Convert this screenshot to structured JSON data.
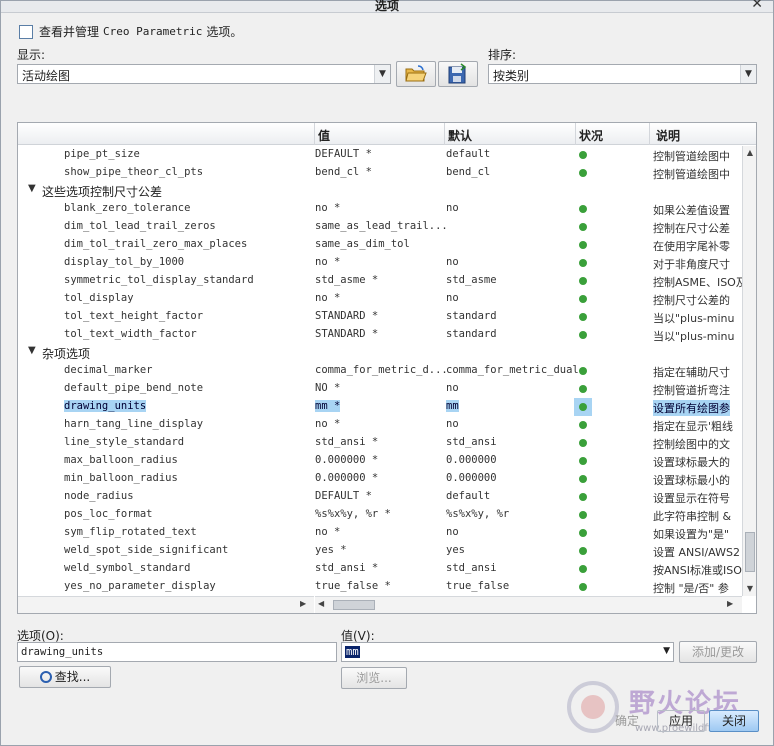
{
  "window": {
    "title": "选项"
  },
  "checkbox": {
    "label_prefix": "查看并管理",
    "label_product": "Creo Parametric",
    "label_suffix": "选项。"
  },
  "display": {
    "label": "显示:",
    "value": "活动绘图"
  },
  "sort": {
    "label": "排序:",
    "value": "按类别"
  },
  "toolbar": {
    "open_icon": "folder-open-icon",
    "save_icon": "save-icon"
  },
  "table": {
    "columns": [
      "值",
      "默认",
      "状况",
      "说明"
    ],
    "rows": [
      {
        "type": "opt",
        "name": "pipe_pt_size",
        "value": "DEFAULT *",
        "default": "default",
        "desc": "控制管道绘图中"
      },
      {
        "type": "opt",
        "name": "show_pipe_theor_cl_pts",
        "value": "bend_cl *",
        "default": "bend_cl",
        "desc": "控制管道绘图中"
      },
      {
        "type": "group",
        "label": "这些选项控制尺寸公差"
      },
      {
        "type": "opt",
        "name": "blank_zero_tolerance",
        "value": "no *",
        "default": "no",
        "desc": "如果公差值设置"
      },
      {
        "type": "opt",
        "name": "dim_tol_lead_trail_zeros",
        "value": "same_as_lead_trail...",
        "default": "",
        "desc": "控制在尺寸公差"
      },
      {
        "type": "opt",
        "name": "dim_tol_trail_zero_max_places",
        "value": "same_as_dim_tol",
        "default": "",
        "desc": "在使用字尾补零"
      },
      {
        "type": "opt",
        "name": "display_tol_by_1000",
        "value": "no *",
        "default": "no",
        "desc": "对于非角度尺寸"
      },
      {
        "type": "opt",
        "name": "symmetric_tol_display_standard",
        "value": "std_asme *",
        "default": "std_asme",
        "desc": "控制ASME、ISO及"
      },
      {
        "type": "opt",
        "name": "tol_display",
        "value": "no *",
        "default": "no",
        "desc": "控制尺寸公差的"
      },
      {
        "type": "opt",
        "name": "tol_text_height_factor",
        "value": "STANDARD *",
        "default": "standard",
        "desc": "当以\"plus-minu"
      },
      {
        "type": "opt",
        "name": "tol_text_width_factor",
        "value": "STANDARD *",
        "default": "standard",
        "desc": "当以\"plus-minu"
      },
      {
        "type": "group",
        "label": "杂项选项"
      },
      {
        "type": "opt",
        "name": "decimal_marker",
        "value": "comma_for_metric_d...",
        "default": "comma_for_metric_dual",
        "desc": "指定在辅助尺寸"
      },
      {
        "type": "opt",
        "name": "default_pipe_bend_note",
        "value": "NO *",
        "default": "no",
        "desc": "控制管道折弯注"
      },
      {
        "type": "opt",
        "name": "drawing_units",
        "value": "mm *",
        "default": "mm",
        "desc": "设置所有绘图参",
        "selected": true
      },
      {
        "type": "opt",
        "name": "harn_tang_line_display",
        "value": "no *",
        "default": "no",
        "desc": "指定在显示'粗线"
      },
      {
        "type": "opt",
        "name": "line_style_standard",
        "value": "std_ansi *",
        "default": "std_ansi",
        "desc": "控制绘图中的文"
      },
      {
        "type": "opt",
        "name": "max_balloon_radius",
        "value": "0.000000 *",
        "default": "0.000000",
        "desc": "设置球标最大的"
      },
      {
        "type": "opt",
        "name": "min_balloon_radius",
        "value": "0.000000 *",
        "default": "0.000000",
        "desc": "设置球标最小的"
      },
      {
        "type": "opt",
        "name": "node_radius",
        "value": "DEFAULT *",
        "default": "default",
        "desc": "设置显示在符号"
      },
      {
        "type": "opt",
        "name": "pos_loc_format",
        "value": "%s%x%y, %r *",
        "default": "%s%x%y, %r",
        "desc": "此字符串控制 &"
      },
      {
        "type": "opt",
        "name": "sym_flip_rotated_text",
        "value": "no *",
        "default": "no",
        "desc": "如果设置为\"是\""
      },
      {
        "type": "opt",
        "name": "weld_spot_side_significant",
        "value": "yes *",
        "default": "yes",
        "desc": "设置 ANSI/AWS2"
      },
      {
        "type": "opt",
        "name": "weld_symbol_standard",
        "value": "std_ansi *",
        "default": "std_ansi",
        "desc": "按ANSI标准或ISO"
      },
      {
        "type": "opt",
        "name": "yes_no_parameter_display",
        "value": "true_false *",
        "default": "true_false",
        "desc": "控制 \"是/否\" 参"
      }
    ]
  },
  "option_field": {
    "label": "选项(O):",
    "value": "drawing_units"
  },
  "value_field": {
    "label": "值(V):",
    "value": "mm"
  },
  "buttons": {
    "add_change": "添加/更改",
    "find": "查找...",
    "browse": "浏览...",
    "ok": "确定",
    "apply": "应用",
    "close": "关闭"
  },
  "watermark": {
    "text": "野火论坛",
    "url": "www.proewildfire.cn"
  },
  "colors": {
    "status_ok": "#3aa03a",
    "selection": "#a8d4f3"
  }
}
